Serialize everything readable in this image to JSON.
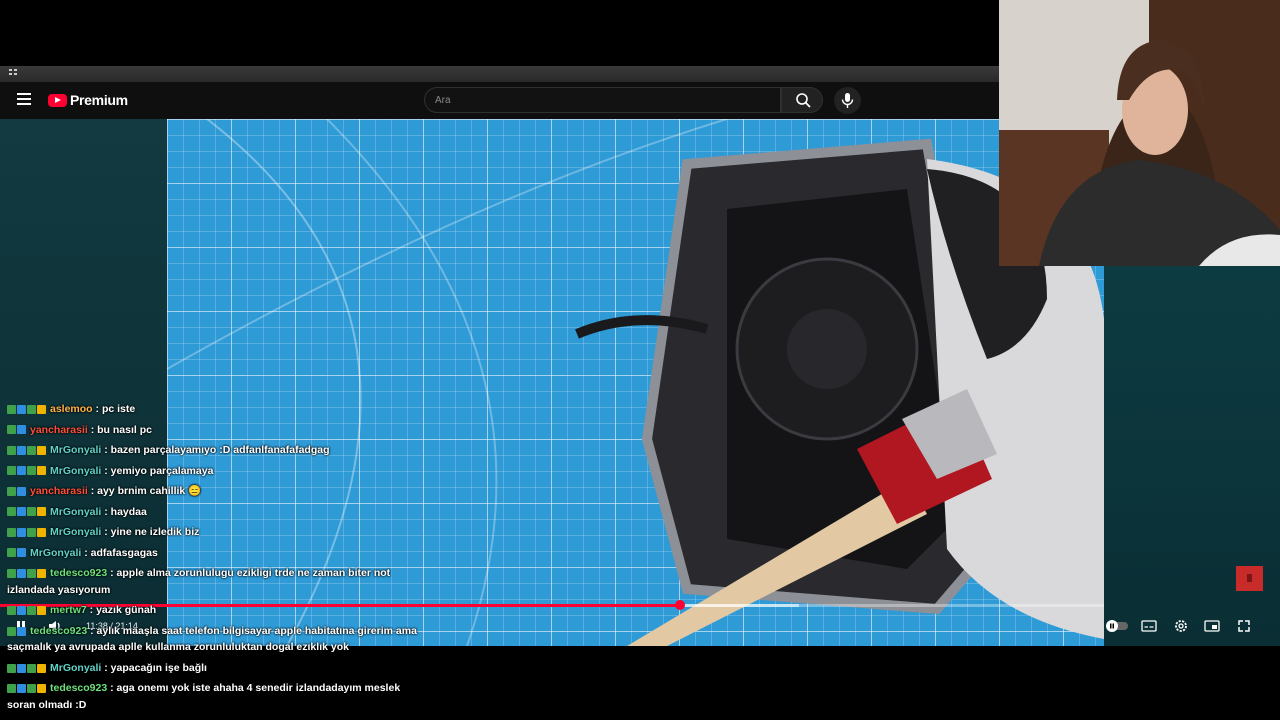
{
  "header": {
    "logo_text": "Premium",
    "search_placeholder": "Ara"
  },
  "player": {
    "time": "11:38 / 21:14",
    "progress": 0.548,
    "buffered": 0.674
  },
  "chat": {
    "messages": [
      {
        "user": "aslemoo",
        "text": " : pc iste",
        "color": "#ffb347"
      },
      {
        "user": "yancharasii",
        "text": " : bu nasıl pc",
        "color": "#ff4e3a"
      },
      {
        "user": "MrGonyali",
        "text": " : bazen parçalayamıyo :D adfanlfanafafadgag",
        "color": "#5fd3c8"
      },
      {
        "user": "MrGonyali",
        "text": " : yemiyo parçalamaya",
        "color": "#5fd3c8"
      },
      {
        "user": "yancharasii",
        "text": " : ayy brnim cahillik 😑",
        "color": "#ff4e3a"
      },
      {
        "user": "MrGonyali",
        "text": " : haydaa",
        "color": "#5fd3c8"
      },
      {
        "user": "MrGonyali",
        "text": " : yine ne izledik biz",
        "color": "#5fd3c8"
      },
      {
        "user": "MrGonyali",
        "text": " : adfafasgagas",
        "color": "#5fd3c8"
      },
      {
        "user": "tedesco923",
        "text": " : apple alma zorunlulugu ezikligi trde ne zaman biter not izlandada yasıyorum",
        "color": "#6ee07a"
      },
      {
        "user": "mertw7",
        "text": " : yazık günah",
        "color": "#6ee07a"
      },
      {
        "user": "tedesco923",
        "text": " : aylık maaşla saat telefon bilgisayar apple habitatına girerim ama saçmalık ya avrupada aplle kullanma zorunluluktan dogal ezıklık yok",
        "color": "#6ee07a"
      },
      {
        "user": "MrGonyali",
        "text": " : yapacağın işe bağlı",
        "color": "#5fd3c8"
      },
      {
        "user": "tedesco923",
        "text": " : aga onemı yok iste ahaha 4 senedir izlandadayım meslek soran olmadı :D",
        "color": "#6ee07a"
      }
    ]
  }
}
